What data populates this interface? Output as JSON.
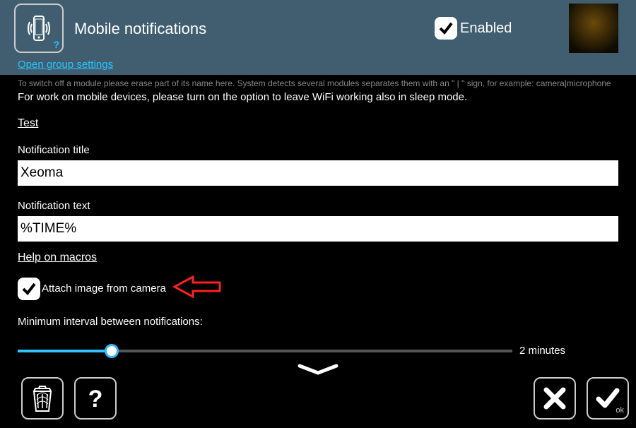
{
  "header": {
    "title": "Mobile notifications",
    "enabled_label": "Enabled",
    "enabled_checked": true,
    "group_settings_link": "Open group settings"
  },
  "body": {
    "truncated_desc": "To switch off a module please erase part of its name here. System detects several modules separates them with an \" | \" sign, for example: camera|microphone",
    "wifi_hint": "For work on mobile devices, please turn on the option to leave WiFi working also in sleep mode.",
    "test_link": "Test",
    "notification_title_label": "Notification title",
    "notification_title_value": "Xeoma",
    "notification_text_label": "Notification text",
    "notification_text_value": "%TIME%",
    "help_macros_link": "Help on macros",
    "attach_image_label": "Attach image from camera",
    "attach_image_checked": true,
    "interval_label": "Minimum interval between notifications:",
    "interval_value": "2 minutes",
    "interval_percent": 19
  },
  "footer": {
    "ok_sub": "ok"
  }
}
